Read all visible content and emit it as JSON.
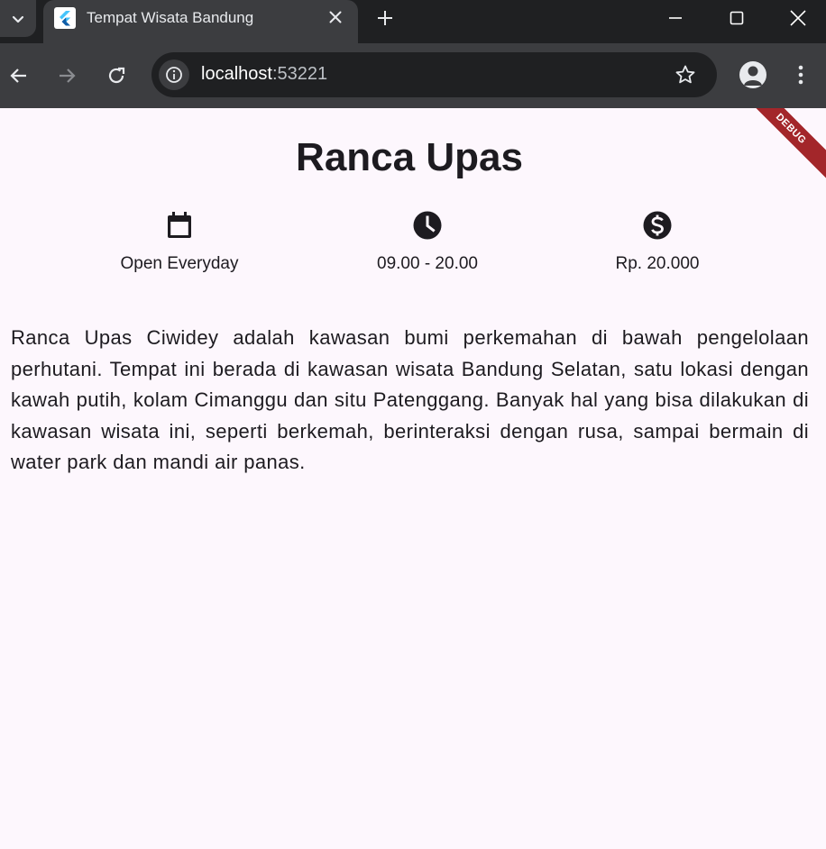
{
  "browser": {
    "tab_title": "Tempat Wisata Bandung",
    "url_host": "localhost",
    "url_port": ":53221"
  },
  "page": {
    "title": "Ranca Upas",
    "info": [
      {
        "icon": "calendar-icon",
        "label": "Open Everyday"
      },
      {
        "icon": "clock-icon",
        "label": "09.00 - 20.00"
      },
      {
        "icon": "dollar-icon",
        "label": "Rp. 20.000"
      }
    ],
    "description": "Ranca Upas Ciwidey adalah kawasan bumi perkemahan di bawah pengelolaan perhutani. Tempat ini berada di kawasan wisata Bandung Selatan, satu lokasi dengan kawah putih, kolam Cimanggu dan situ Patenggang. Banyak hal yang bisa dilakukan di kawasan wisata ini, seperti berkemah, berinteraksi dengan rusa, sampai bermain di water park dan mandi air panas.",
    "debug_label": "DEBUG"
  },
  "colors": {
    "chrome_dark": "#1f2022",
    "chrome_mid": "#3c3d40",
    "page_bg": "#fdf7fd",
    "text": "#1d1b20",
    "debug_banner": "#a3262a"
  }
}
